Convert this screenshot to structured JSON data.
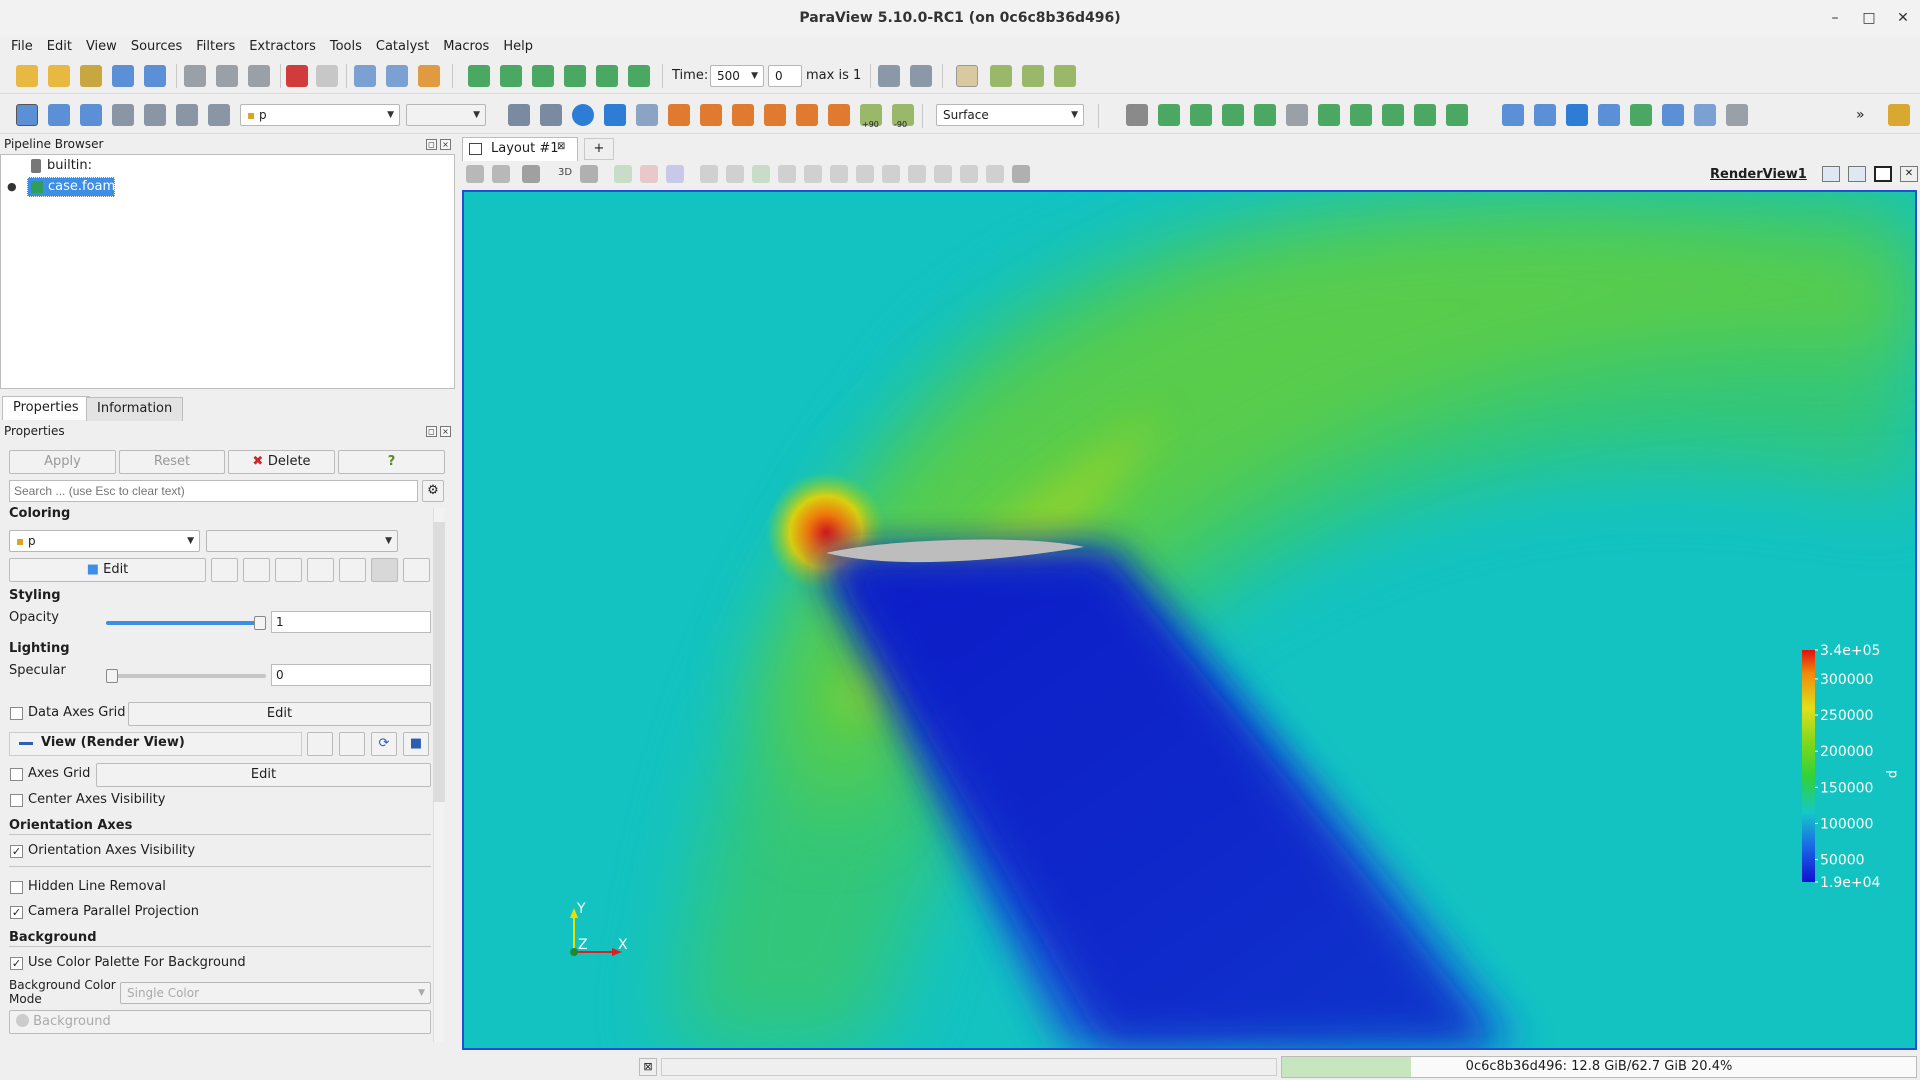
{
  "window": {
    "title": "ParaView 5.10.0-RC1 (on 0c6c8b36d496)",
    "minimize": "–",
    "maximize": "□",
    "close": "✕"
  },
  "menu": [
    "File",
    "Edit",
    "View",
    "Sources",
    "Filters",
    "Extractors",
    "Tools",
    "Catalyst",
    "Macros",
    "Help"
  ],
  "time": {
    "label": "Time:",
    "value": "500",
    "index": "0",
    "max_label": "max is 1"
  },
  "toolbar2": {
    "variable": "p",
    "component": "",
    "representation": "Surface",
    "rot_plus90": "+90",
    "rot_minus90": "-90",
    "overflow": "»"
  },
  "pipeline": {
    "title": "Pipeline Browser",
    "items": [
      {
        "label": "builtin:"
      },
      {
        "label": "case.foam"
      }
    ]
  },
  "tabs": {
    "properties": "Properties",
    "information": "Information"
  },
  "properties": {
    "title": "Properties",
    "apply": "Apply",
    "reset": "Reset",
    "delete": "Delete",
    "help": "?",
    "search_placeholder": "Search ... (use Esc to clear text)",
    "coloring": {
      "header": "Coloring",
      "variable": "p",
      "component": "",
      "edit": "Edit"
    },
    "styling": {
      "header": "Styling",
      "opacity_label": "Opacity",
      "opacity_value": "1",
      "opacity_slider": 1.0
    },
    "lighting": {
      "header": "Lighting",
      "specular_label": "Specular",
      "specular_value": "0",
      "specular_slider": 0.0
    },
    "data_axes_grid": {
      "label": "Data Axes Grid",
      "edit": "Edit",
      "checked": false
    },
    "view_header": "View (Render View)",
    "axes_grid": {
      "label": "Axes Grid",
      "edit": "Edit",
      "checked": false
    },
    "center_axes": {
      "label": "Center Axes Visibility",
      "checked": false
    },
    "orientation_header": "Orientation Axes",
    "orientation_vis": {
      "label": "Orientation Axes Visibility",
      "checked": true
    },
    "hidden_line": {
      "label": "Hidden Line Removal",
      "checked": false
    },
    "camera_parallel": {
      "label": "Camera Parallel Projection",
      "checked": true
    },
    "background_header": "Background",
    "use_palette": {
      "label": "Use Color Palette For Background",
      "checked": true
    },
    "bg_mode_label_1": "Background Color",
    "bg_mode_label_2": "Mode",
    "bg_mode_value": "Single Color",
    "bg_color_label": "Background",
    "checkmark": "✓"
  },
  "layout": {
    "tab": "Layout #1",
    "add_tab": "+",
    "view_name": "RenderView1",
    "mode_3d": "3D"
  },
  "axes": {
    "y": "Y",
    "z": "Z",
    "x": "X"
  },
  "colorbar": {
    "title": "p",
    "labels": [
      "3.4e+05",
      "300000",
      "250000",
      "200000",
      "150000",
      "100000",
      "50000",
      "1.9e+04"
    ],
    "range": [
      19000,
      340000
    ]
  },
  "status": {
    "memory": "0c6c8b36d496: 12.8 GiB/62.7 GiB 20.4%",
    "memory_fraction": 0.204
  },
  "colors": {
    "accent": "#1f4fd8",
    "selection": "#3d8ee6",
    "undo": "#d13b3b"
  }
}
